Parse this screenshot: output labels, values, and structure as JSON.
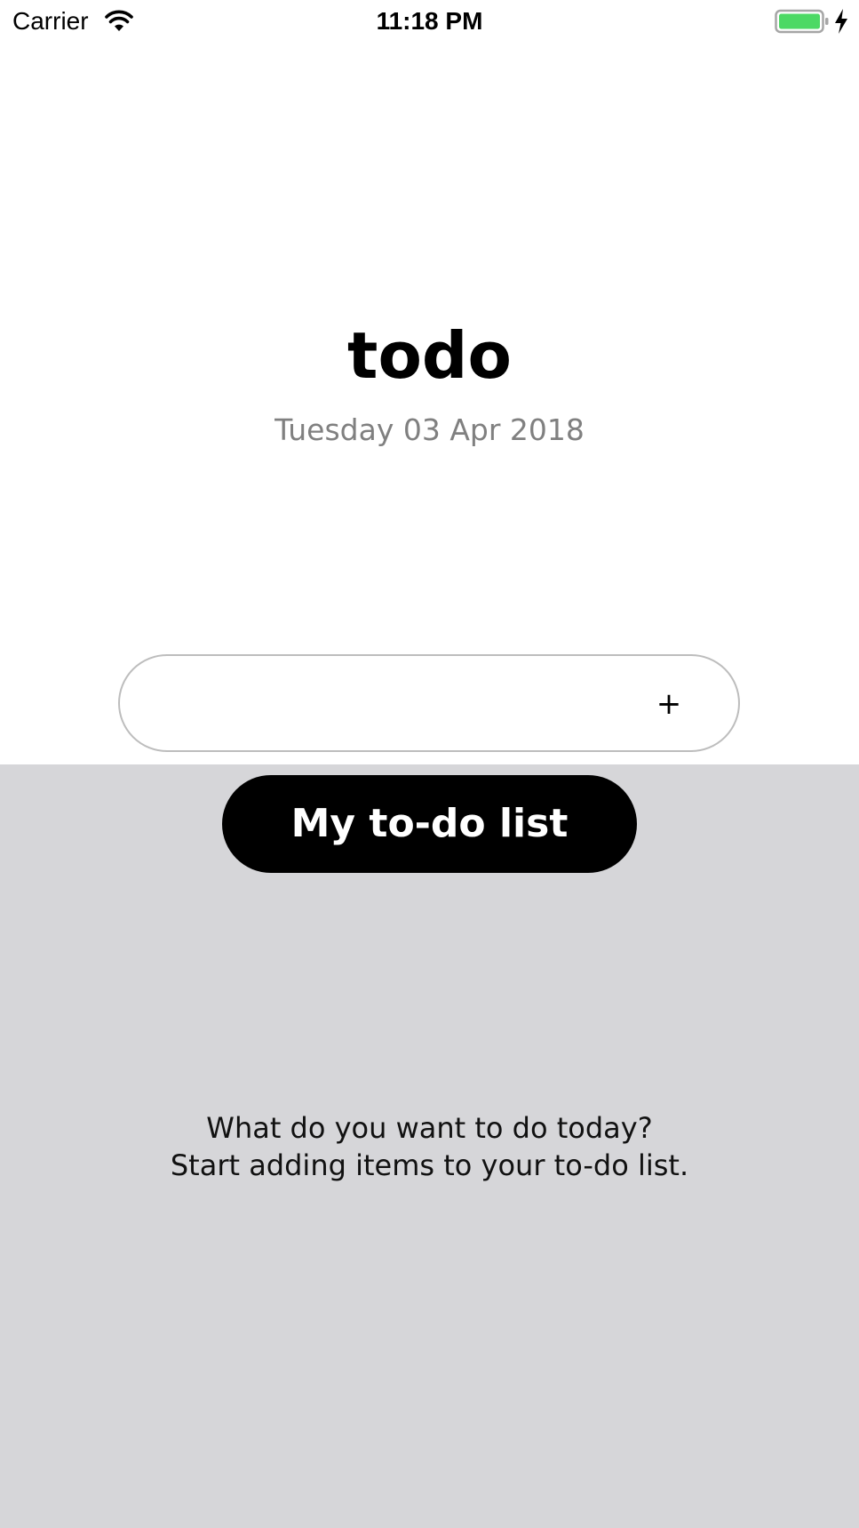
{
  "status_bar": {
    "carrier": "Carrier",
    "time": "11:18 PM",
    "icons": [
      "wifi-icon",
      "battery-icon",
      "charging-icon"
    ],
    "battery_color": "#4cd964"
  },
  "header": {
    "title": "todo",
    "date": "Tuesday 03 Apr 2018"
  },
  "new_item": {
    "value": "",
    "placeholder": "",
    "add_label": "+"
  },
  "list": {
    "title": "My to-do list",
    "empty_line1": "What do you want to do today?",
    "empty_line2": "Start adding items to your to-do list."
  },
  "colors": {
    "list_background": "#d6d6d9",
    "pill_background": "#000000",
    "date_text": "#808080"
  }
}
